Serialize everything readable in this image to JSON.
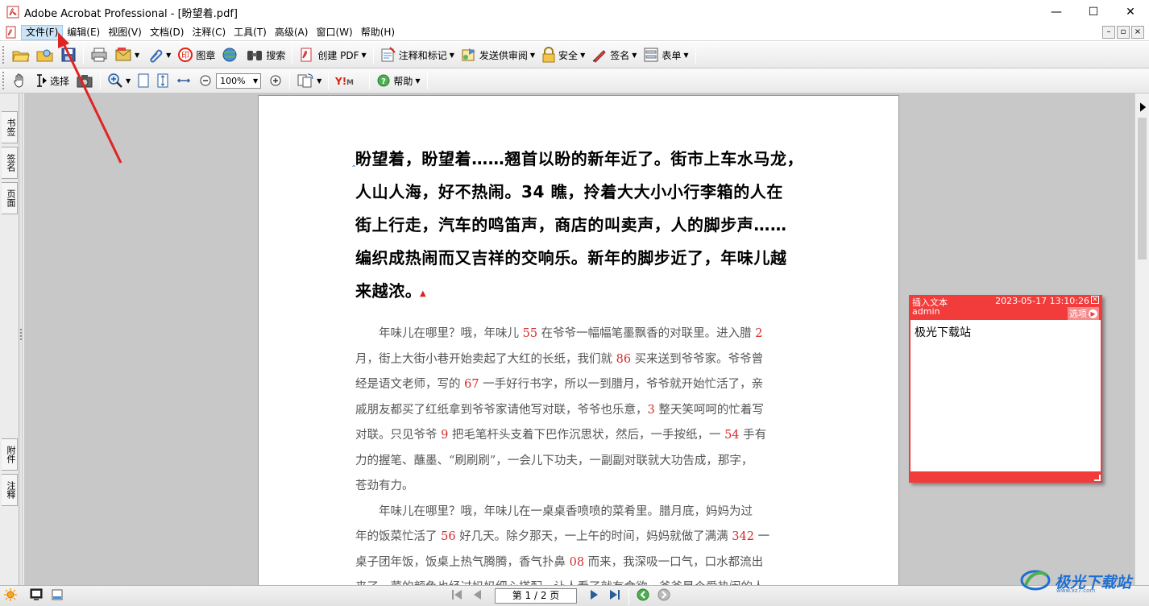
{
  "window": {
    "title": "Adobe Acrobat Professional - [盼望着.pdf]",
    "controls": [
      "—",
      "☐",
      "✕"
    ]
  },
  "menu": {
    "items": [
      "文件(F)",
      "编辑(E)",
      "视图(V)",
      "文档(D)",
      "注释(C)",
      "工具(T)",
      "高级(A)",
      "窗口(W)",
      "帮助(H)"
    ],
    "active_index": 0,
    "mdi_controls": [
      "–",
      "▫",
      "×"
    ]
  },
  "toolbar1": {
    "stamp_label": "图章",
    "search_label": "搜索",
    "create_pdf_label": "创建 PDF",
    "comment_markup_label": "注释和标记",
    "send_review_label": "发送供审阅",
    "security_label": "安全",
    "sign_label": "签名",
    "forms_label": "表单"
  },
  "toolbar2": {
    "select_label": "选择",
    "zoom_value": "100%",
    "help_label": "帮助"
  },
  "navpanel": {
    "tabs_top": [
      "书签",
      "签名",
      "页面"
    ],
    "tabs_bottom": [
      "附件",
      "注释"
    ]
  },
  "document": {
    "heading_lines": [
      "盼望着，盼望着……翘首以盼的新年近了。街市上车水马龙，",
      "人山人海，好不热闹。34 瞧，拎着大大小小行李箱的人在",
      "街上行走，汽车的鸣笛声，商店的叫卖声，人的脚步声……",
      "编织成热闹而又吉祥的交响乐。新年的脚步近了，年味儿越",
      "来越浓。"
    ],
    "body_lines": [
      [
        {
          "t": "　　年味儿在哪里？哦，年味儿 "
        },
        {
          "n": "55"
        },
        {
          "t": " 在爷爷一幅幅笔墨飘香的对联里。进入腊 "
        },
        {
          "n": "2"
        }
      ],
      [
        {
          "t": "月，街上大街小巷开始卖起了大红的长纸，我们就 "
        },
        {
          "n": "86"
        },
        {
          "t": " 买来送到爷爷家。爷爷曾"
        }
      ],
      [
        {
          "t": "经是语文老师，写的 "
        },
        {
          "n": "67"
        },
        {
          "t": " 一手好行书字，所以一到腊月，爷爷就开始忙活了，亲"
        }
      ],
      [
        {
          "t": "戚朋友都买了红纸拿到爷爷家请他写对联，爷爷也乐意，"
        },
        {
          "n": "3"
        },
        {
          "t": " 整天笑呵呵的忙着写"
        }
      ],
      [
        {
          "t": "对联。只见爷爷 "
        },
        {
          "n": "9"
        },
        {
          "t": " 把毛笔杆头支着下巴作沉思状，然后，一手按纸，一 "
        },
        {
          "n": "54"
        },
        {
          "t": " 手有"
        }
      ],
      [
        {
          "t": "力的握笔、蘸墨、“刷刷刷”，一会儿下功夫，一副副对联就大功告成，那字，"
        }
      ],
      [
        {
          "t": "苍劲有力。"
        }
      ],
      [
        {
          "t": "　　年味儿在哪里？哦，年味儿在一桌桌香喷喷的菜肴里。腊月底，妈妈为过"
        }
      ],
      [
        {
          "t": "年的饭菜忙活了 "
        },
        {
          "n": "56"
        },
        {
          "t": " 好几天。除夕那天，一上午的时间，妈妈就做了满满 "
        },
        {
          "n": "342"
        },
        {
          "t": " 一"
        }
      ],
      [
        {
          "t": "桌子团年饭，饭桌上热气腾腾，香气扑鼻 "
        },
        {
          "n": "08"
        },
        {
          "t": " 而来，我深吸一口气，口水都流出"
        }
      ],
      [
        {
          "t": "来了，菜的颜色也经过妈妈细心搭配，让人看了就有食欲，爸爸是个爱热闹的人，"
        }
      ]
    ]
  },
  "note": {
    "type": "插入文本",
    "timestamp": "2023-05-17 13:10:26",
    "author": "admin",
    "options_label": "选项",
    "content": "极光下载站",
    "color": "#f23c3c"
  },
  "statusbar": {
    "page_indicator": "第 1 / 2 页"
  },
  "watermark": {
    "text": "极光下载站",
    "sub": "www.xz7.com"
  }
}
